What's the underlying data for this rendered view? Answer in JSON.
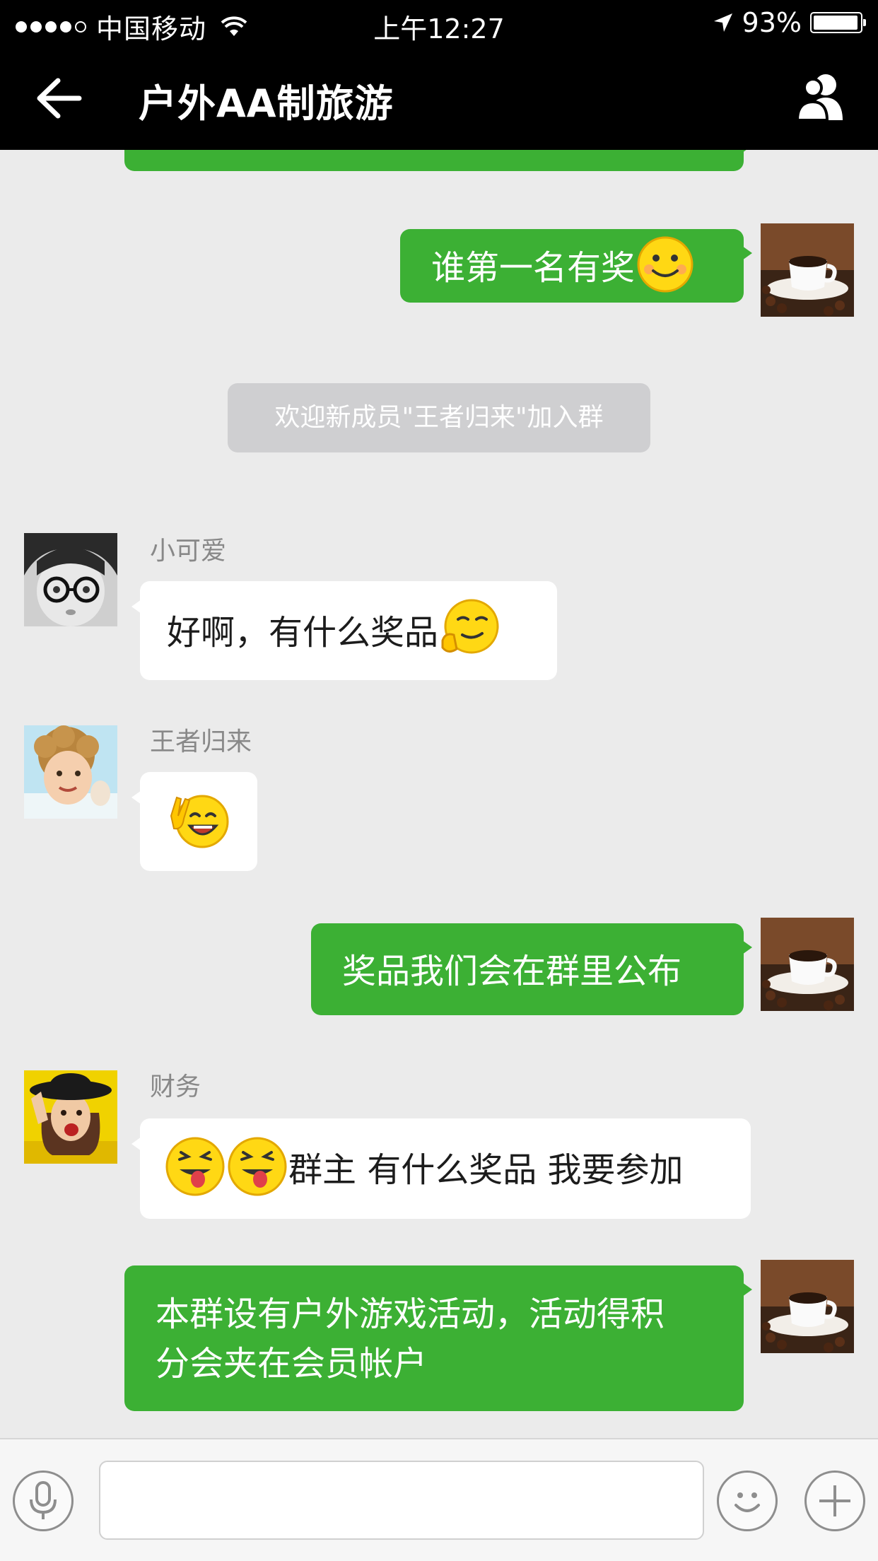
{
  "status_bar": {
    "carrier": "中国移动",
    "time": "上午12:27",
    "battery": "93%",
    "battery_level": 0.93
  },
  "header": {
    "title": "户外AA制旅游",
    "back_icon": "back-arrow-icon",
    "members_icon": "group-members-icon"
  },
  "messages": {
    "m1": {
      "text": "谁第一名有奖",
      "direction": "out",
      "emoji": "smile-face"
    },
    "system": {
      "text": "欢迎新成员\"王者归来\"加入群"
    },
    "m2": {
      "sender": "小可爱",
      "text": "好啊，有什么奖品",
      "direction": "in",
      "emoji": "smirk-thumb-face"
    },
    "m3": {
      "sender": "王者归来",
      "text": "",
      "direction": "in",
      "emoji": "victory-laugh-face"
    },
    "m4": {
      "text": "奖品我们会在群里公布",
      "direction": "out"
    },
    "m5": {
      "sender": "财务",
      "text": "群主 有什么奖品 我要参加",
      "direction": "in",
      "emoji": "tongue-face x2"
    },
    "m6": {
      "line1": "本群设有户外游戏活动，活动得积",
      "line2": "分会夹在会员帐户",
      "direction": "out"
    }
  },
  "input_bar": {
    "voice_icon": "microphone-icon",
    "emoji_icon": "emoji-icon",
    "more_icon": "plus-icon",
    "placeholder": ""
  },
  "colors": {
    "outgoing_bubble": "#3cb034",
    "incoming_bubble": "#ffffff",
    "chat_background": "#ebebeb",
    "header_background": "#000000"
  }
}
